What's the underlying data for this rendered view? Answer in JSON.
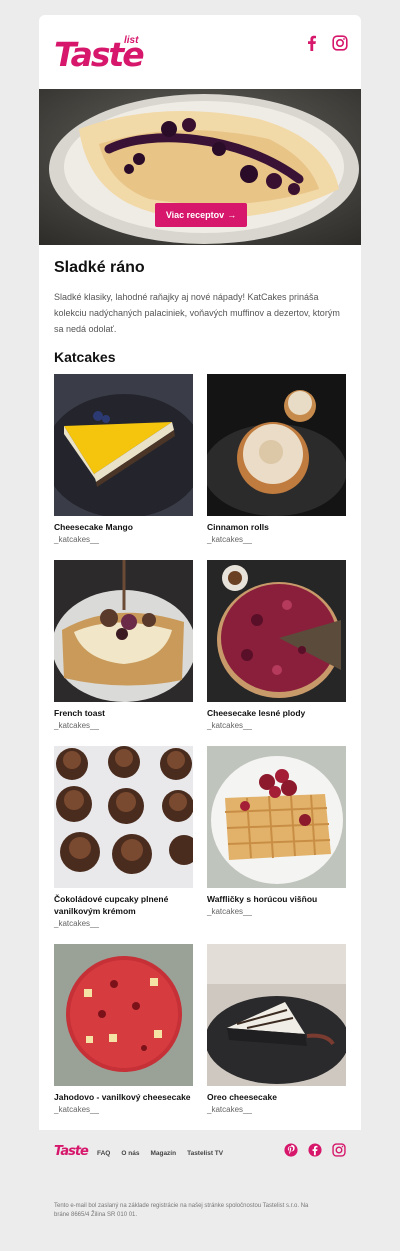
{
  "brand": {
    "logo_text": "Taste",
    "logo_sup": "list",
    "accent": "#d6176b"
  },
  "header": {
    "social": [
      "facebook-icon",
      "instagram-icon"
    ]
  },
  "hero": {
    "button_label": "Viac receptov",
    "button_arrow": "→"
  },
  "content": {
    "title": "Sladké ráno",
    "intro": "Sladké klasiky, lahodné raňajky aj nové nápady! KatCakes prináša kolekciu nadýchaných palaciniek, voňavých muffinov a dezertov, ktorým sa nedá odolať.",
    "section_title": "Katcakes"
  },
  "recipes": [
    {
      "name": "Cheesecake Mango",
      "author": "_katcakes__"
    },
    {
      "name": "Cinnamon rolls",
      "author": "_katcakes__"
    },
    {
      "name": "French toast",
      "author": "_katcakes__"
    },
    {
      "name": "Cheesecake lesné plody",
      "author": "_katcakes__"
    },
    {
      "name": "Čokoládové cupcaky plnené vanilkovým krémom",
      "author": "_katcakes__"
    },
    {
      "name": "Waffličky s horúcou višňou",
      "author": "_katcakes__"
    },
    {
      "name": "Jahodovo - vanilkový cheesecake",
      "author": "_katcakes__"
    },
    {
      "name": "Oreo cheesecake",
      "author": "_katcakes__"
    }
  ],
  "footer": {
    "logo_text": "Taste",
    "links": [
      "FAQ",
      "O nás",
      "Magazín",
      "Tastelist TV"
    ],
    "social": [
      "pinterest-icon",
      "facebook-icon",
      "instagram-icon"
    ],
    "legal": "Tento e-mail bol zaslaný na základe registrácie na našej stránke spoločnostou Tastelist s.r.o. Na bráne 8665/4 Žilina SR 010 01."
  }
}
